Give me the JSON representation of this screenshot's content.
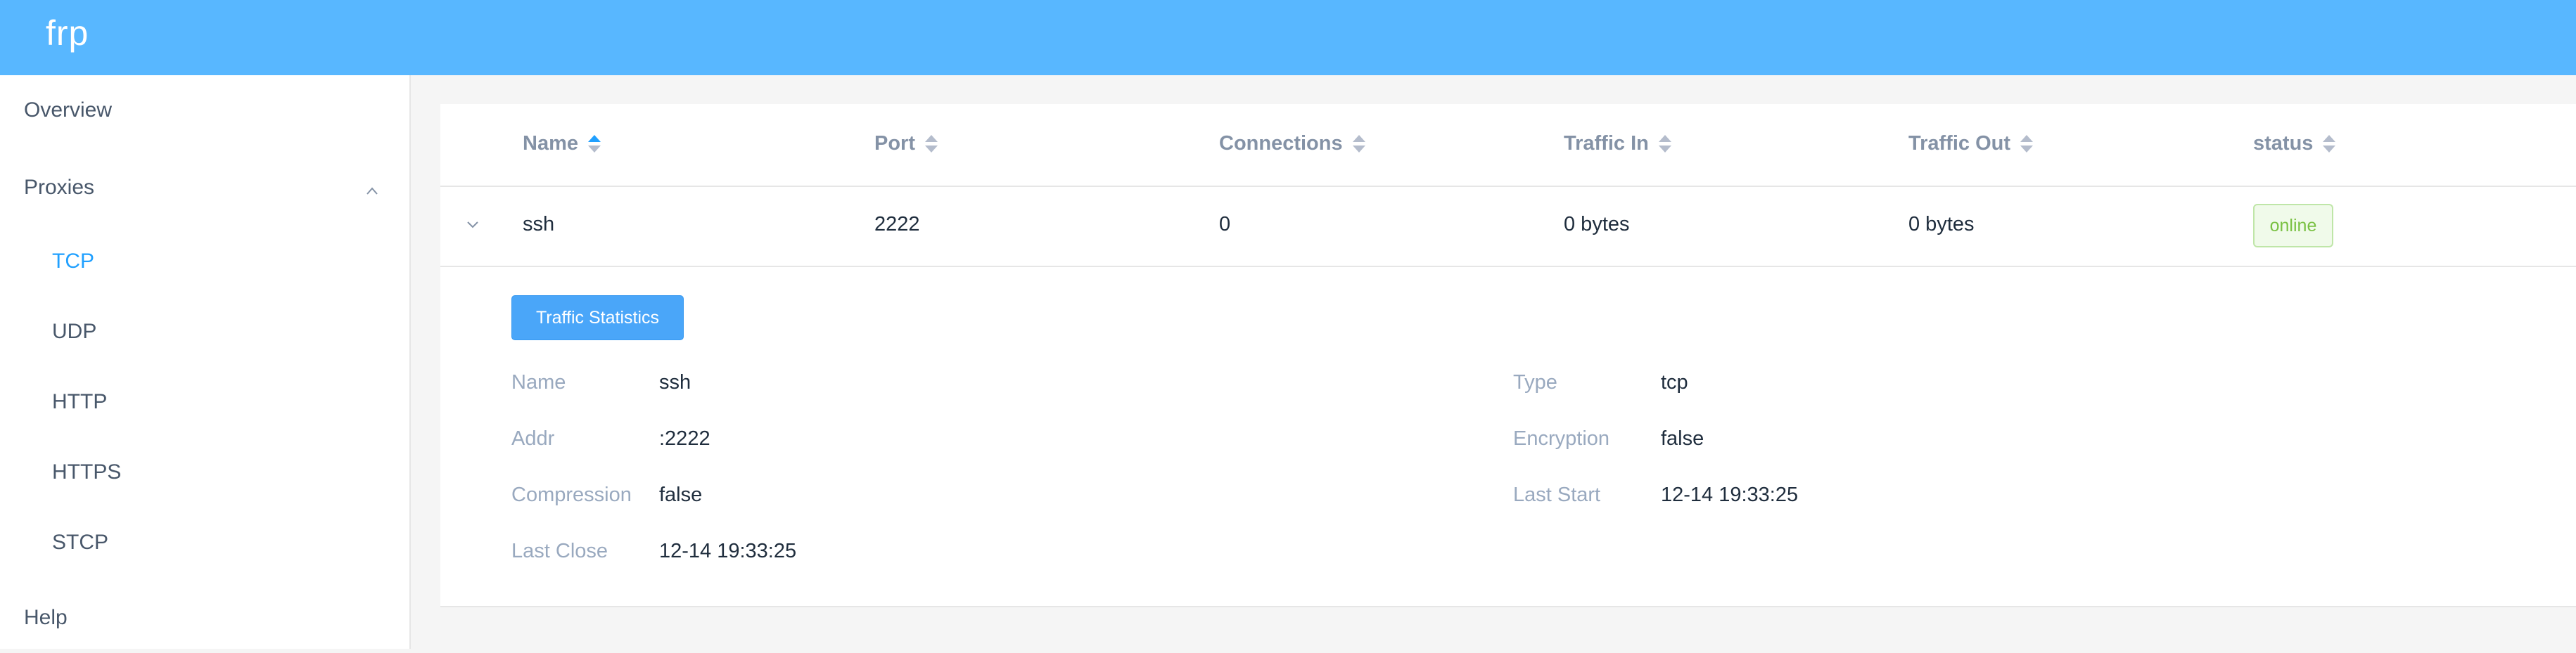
{
  "app": {
    "title": "frp"
  },
  "sidebar": {
    "items": [
      {
        "label": "Overview"
      },
      {
        "label": "Proxies",
        "expanded": true,
        "icon": "chevron-up-icon"
      },
      {
        "label": "TCP",
        "active": true
      },
      {
        "label": "UDP"
      },
      {
        "label": "HTTP"
      },
      {
        "label": "HTTPS"
      },
      {
        "label": "STCP"
      },
      {
        "label": "Help"
      }
    ]
  },
  "table": {
    "columns": [
      {
        "label": "Name",
        "sort": "ascending"
      },
      {
        "label": "Port",
        "sort": "none"
      },
      {
        "label": "Connections",
        "sort": "none"
      },
      {
        "label": "Traffic In",
        "sort": "none"
      },
      {
        "label": "Traffic Out",
        "sort": "none"
      },
      {
        "label": "status",
        "sort": "none"
      }
    ],
    "rows": [
      {
        "name": "ssh",
        "port": "2222",
        "connections": "0",
        "traffic_in": "0 bytes",
        "traffic_out": "0 bytes",
        "status": "online"
      }
    ]
  },
  "details": {
    "button_label": "Traffic Statistics",
    "left": [
      {
        "label": "Name",
        "value": "ssh"
      },
      {
        "label": "Addr",
        "value": ":2222"
      },
      {
        "label": "Compression",
        "value": "false"
      },
      {
        "label": "Last Close",
        "value": "12-14 19:33:25"
      }
    ],
    "right": [
      {
        "label": "Type",
        "value": "tcp"
      },
      {
        "label": "Encryption",
        "value": "false"
      },
      {
        "label": "Last Start",
        "value": "12-14 19:33:25"
      }
    ]
  },
  "colors": {
    "header": "#58b7ff",
    "accent": "#20a0ff",
    "button": "#4aa6f9",
    "status_online": "#7ac143"
  }
}
